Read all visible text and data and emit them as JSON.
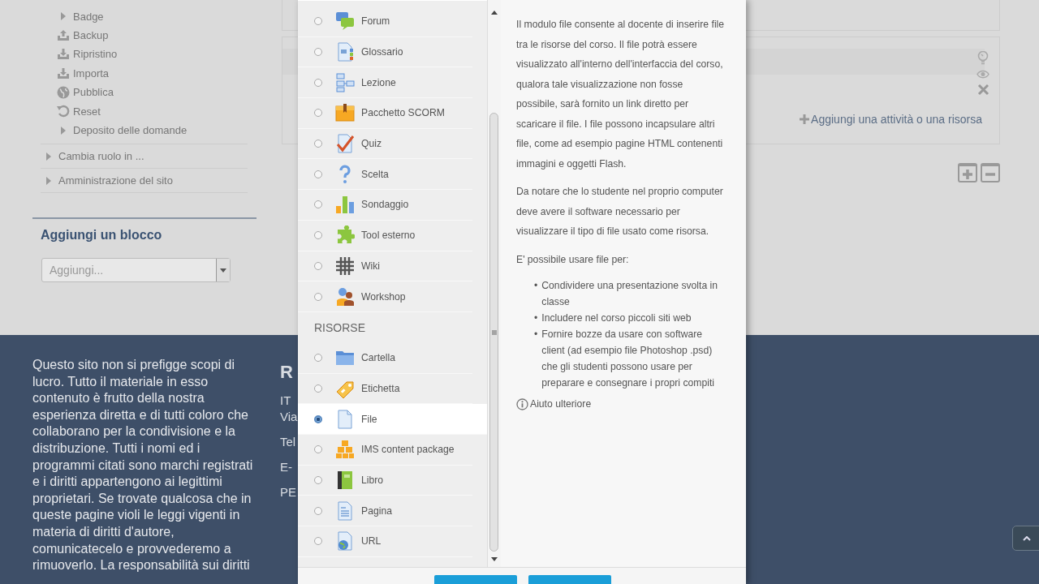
{
  "sidebar": {
    "items": [
      {
        "label": "Badge",
        "kind": "caret"
      },
      {
        "label": "Backup",
        "kind": "upload"
      },
      {
        "label": "Ripristino",
        "kind": "download"
      },
      {
        "label": "Importa",
        "kind": "download"
      },
      {
        "label": "Pubblica",
        "kind": "globe"
      },
      {
        "label": "Reset",
        "kind": "reset"
      },
      {
        "label": "Deposito delle domande",
        "kind": "caret"
      }
    ],
    "sections": [
      {
        "label": "Cambia ruolo in ..."
      },
      {
        "label": "Amministrazione del sito"
      }
    ]
  },
  "add_block": {
    "title": "Aggiungi un blocco",
    "select": {
      "value": "Aggiungi..."
    }
  },
  "course_section": {
    "add_link": "Aggiungi una attività o una risorsa"
  },
  "chooser": {
    "activities": [
      {
        "label": "Forum",
        "kind": "forum",
        "selected": false
      },
      {
        "label": "Glossario",
        "kind": "glossary",
        "selected": false
      },
      {
        "label": "Lezione",
        "kind": "lesson",
        "selected": false
      },
      {
        "label": "Pacchetto SCORM",
        "kind": "scorm",
        "selected": false
      },
      {
        "label": "Quiz",
        "kind": "quiz",
        "selected": false
      },
      {
        "label": "Scelta",
        "kind": "choice",
        "selected": false
      },
      {
        "label": "Sondaggio",
        "kind": "survey",
        "selected": false
      },
      {
        "label": "Tool esterno",
        "kind": "lti",
        "selected": false
      },
      {
        "label": "Wiki",
        "kind": "wiki",
        "selected": false
      },
      {
        "label": "Workshop",
        "kind": "workshop",
        "selected": false
      }
    ],
    "resources": {
      "heading": "RISORSE",
      "items": [
        {
          "label": "Cartella",
          "kind": "folder",
          "selected": false
        },
        {
          "label": "Etichetta",
          "kind": "label",
          "selected": false
        },
        {
          "label": "File",
          "kind": "file",
          "selected": true
        },
        {
          "label": "IMS content package",
          "kind": "ims",
          "selected": false
        },
        {
          "label": "Libro",
          "kind": "book",
          "selected": false
        },
        {
          "label": "Pagina",
          "kind": "page",
          "selected": false
        },
        {
          "label": "URL",
          "kind": "url",
          "selected": false
        }
      ]
    },
    "description": {
      "paragraphs": [
        "Il modulo file consente al docente di inserire file tra le risorse del corso. Il file potrà essere visualizzato all'interno dell'interfaccia del corso, qualora tale visualizzazione non fosse possibile, sarà fornito un link diretto per scaricare il file. I file possono incapsulare altri file, come ad esempio pagine HTML contenenti immagini e oggetti Flash.",
        "Da notare che lo studente nel proprio computer deve avere il software necessario per visualizzare il tipo di file usato come risorsa.",
        "E' possibile usare file per:"
      ],
      "bullet": "•",
      "uses": [
        "Condividere una presentazione svolta in classe",
        "Includere nel corso piccoli siti web",
        "Fornire bozze da usare con software client (ad esempio file Photoshop .psd) che gli studenti possono usare per preparare e consegnare i propri compiti"
      ],
      "help_link": "Aiuto ulteriore"
    }
  },
  "footer": {
    "text": "Questo sito non si prefigge scopi di lucro. Tutto il materiale in esso contenuto è frutto della nostra esperienza diretta e di tutti coloro che collaborano per la condivisione e la distribuzione. Tutti i nomi ed i programmi citati sono marchi registrati e i diritti appartengono ai legittimi proprietari. Se trovate qualcosa che in queste pagine violi le leggi vigenti in materia di diritti d'autore, comunicatecelo e provvederemo a rimuoverlo. La responsabilità sui diritti",
    "contact_heading": "R",
    "contact_lines": [
      "IT",
      "Via",
      "Tel",
      "E-",
      "PE"
    ]
  }
}
